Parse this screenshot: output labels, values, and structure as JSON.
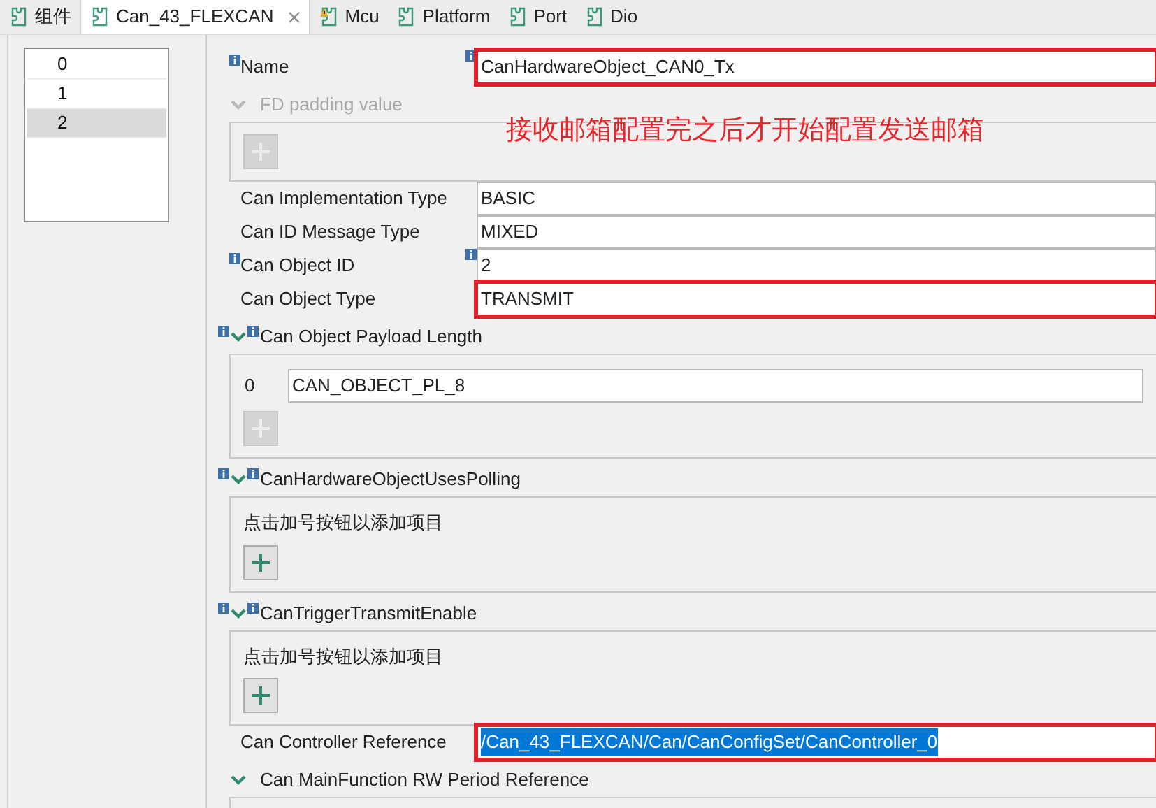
{
  "tabs": [
    {
      "label": "组件",
      "selected": false,
      "warning": false,
      "closable": false
    },
    {
      "label": "Can_43_FLEXCAN",
      "selected": true,
      "warning": false,
      "closable": true
    },
    {
      "label": "Mcu",
      "selected": false,
      "warning": true,
      "closable": false
    },
    {
      "label": "Platform",
      "selected": false,
      "warning": false,
      "closable": false
    },
    {
      "label": "Port",
      "selected": false,
      "warning": false,
      "closable": false
    },
    {
      "label": "Dio",
      "selected": false,
      "warning": false,
      "closable": false
    }
  ],
  "index_list": [
    {
      "label": "0",
      "selected": false
    },
    {
      "label": "1",
      "selected": false
    },
    {
      "label": "2",
      "selected": true
    }
  ],
  "annotation": "接收邮箱配置完之后才开始配置发送邮箱",
  "form": [
    {
      "kind": "field",
      "label": "Name",
      "value": "CanHardwareObject_CAN0_Tx",
      "label_info": true,
      "value_info": true,
      "highlighted": true,
      "value_selected": false
    },
    {
      "kind": "group",
      "title": "FD padding value",
      "info": false,
      "disabled": true,
      "add_enabled": false
    },
    {
      "kind": "field",
      "label": "Can Implementation Type",
      "value": "BASIC",
      "label_info": false,
      "value_info": false,
      "highlighted": false,
      "value_selected": false
    },
    {
      "kind": "field",
      "label": "Can ID Message Type",
      "value": "MIXED",
      "label_info": false,
      "value_info": false,
      "highlighted": false,
      "value_selected": false
    },
    {
      "kind": "field",
      "label": "Can Object ID",
      "value": "2",
      "label_info": true,
      "value_info": true,
      "highlighted": false,
      "value_selected": false
    },
    {
      "kind": "field",
      "label": "Can Object Type",
      "value": "TRANSMIT",
      "label_info": false,
      "value_info": false,
      "highlighted": true,
      "value_selected": false
    },
    {
      "kind": "group",
      "title": "Can Object Payload Length",
      "info": true,
      "disabled": false,
      "add_enabled": false,
      "entries": [
        {
          "index": "0",
          "value": "CAN_OBJECT_PL_8"
        }
      ]
    },
    {
      "kind": "group",
      "title": "CanHardwareObjectUsesPolling",
      "info": true,
      "disabled": false,
      "add_enabled": true,
      "hint": "点击加号按钮以添加项目"
    },
    {
      "kind": "group",
      "title": "CanTriggerTransmitEnable",
      "info": true,
      "disabled": false,
      "add_enabled": true,
      "hint": "点击加号按钮以添加项目"
    },
    {
      "kind": "field",
      "label": "Can Controller Reference",
      "value": "/Can_43_FLEXCAN/Can/CanConfigSet/CanController_0",
      "label_info": false,
      "value_info": false,
      "highlighted": true,
      "value_selected": true
    },
    {
      "kind": "group",
      "title": "Can MainFunction RW Period Reference",
      "info": false,
      "disabled": false,
      "cut": true
    }
  ]
}
